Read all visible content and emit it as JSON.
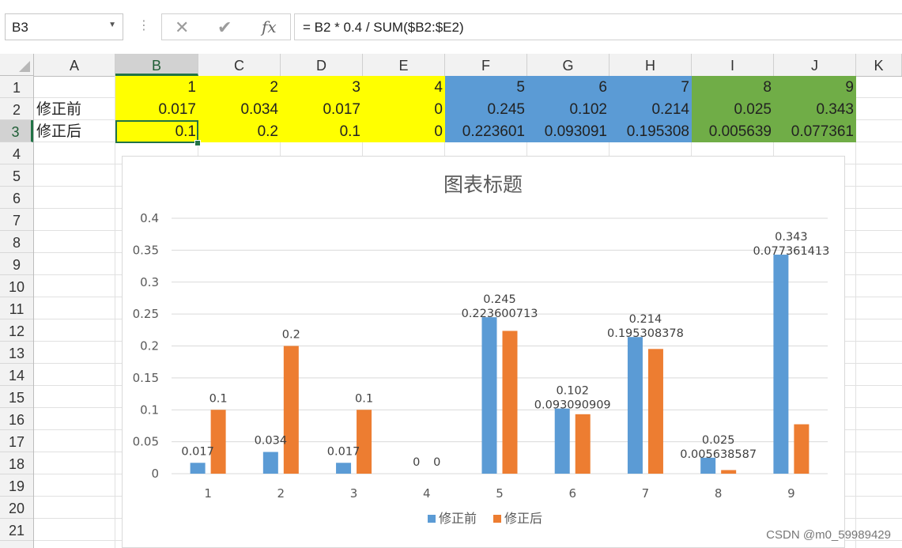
{
  "namebox": {
    "value": "B3",
    "arrow_icon": "chevron-down-icon"
  },
  "formula_bar": {
    "cancel_icon": "cancel-icon",
    "enter_icon": "checkmark-icon",
    "fx_label": "fx",
    "formula": "= B2 * 0.4 / SUM($B2:$E2)"
  },
  "columns": [
    "A",
    "B",
    "C",
    "D",
    "E",
    "F",
    "G",
    "H",
    "I",
    "J",
    "K"
  ],
  "selected_column": "B",
  "rows": [
    "1",
    "2",
    "3",
    "4",
    "5",
    "6",
    "7",
    "8",
    "9",
    "10",
    "11",
    "12",
    "13",
    "14",
    "15",
    "16",
    "17",
    "18",
    "19",
    "20",
    "21"
  ],
  "selected_row": "3",
  "sheet": {
    "row1": [
      "1",
      "2",
      "3",
      "4",
      "5",
      "6",
      "7",
      "8",
      "9"
    ],
    "row2_label": "修正前",
    "row2": [
      "0.017",
      "0.034",
      "0.017",
      "0",
      "0.245",
      "0.102",
      "0.214",
      "0.025",
      "0.343"
    ],
    "row3_label": "修正后",
    "row3": [
      "0.1",
      "0.2",
      "0.1",
      "0",
      "0.223601",
      "0.093091",
      "0.195308",
      "0.005639",
      "0.077361"
    ]
  },
  "colors": {
    "yellow": "#FFFF00",
    "blue_fill": "#5B9BD5",
    "green_fill": "#70AD47",
    "series1": "#5B9BD5",
    "series2": "#ED7D31",
    "accent": "#217346"
  },
  "chart_data": {
    "type": "bar",
    "title": "图表标题",
    "categories": [
      "1",
      "2",
      "3",
      "4",
      "5",
      "6",
      "7",
      "8",
      "9"
    ],
    "series": [
      {
        "name": "修正前",
        "values": [
          0.017,
          0.034,
          0.017,
          0,
          0.245,
          0.102,
          0.214,
          0.025,
          0.343
        ],
        "labels": [
          "0.017",
          "0.034",
          "0.017",
          "0",
          "0.245",
          "0.102",
          "0.214",
          "0.025",
          "0.343"
        ]
      },
      {
        "name": "修正后",
        "values": [
          0.1,
          0.2,
          0.1,
          0,
          0.223600713,
          0.093090909,
          0.195308378,
          0.005638587,
          0.077361413
        ],
        "labels": [
          "0.1",
          "0.2",
          "0.1",
          "0",
          "0.223600713",
          "0.093090909",
          "0.195308378",
          "0.005638587",
          "0.077361413"
        ]
      }
    ],
    "yticks": [
      "0",
      "0.05",
      "0.1",
      "0.15",
      "0.2",
      "0.25",
      "0.3",
      "0.35",
      "0.4"
    ],
    "ylim": [
      0,
      0.4
    ],
    "grid": true,
    "legend": "bottom"
  },
  "watermark": "CSDN @m0_59989429"
}
